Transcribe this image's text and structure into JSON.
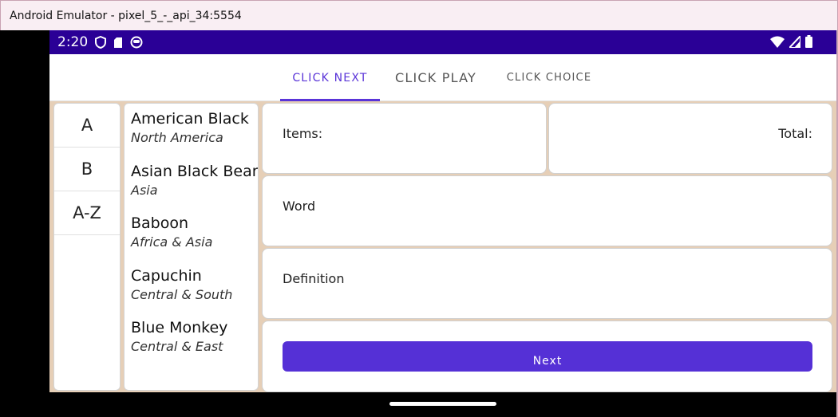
{
  "window": {
    "title": "Android Emulator - pixel_5_-_api_34:5554"
  },
  "status_bar": {
    "time": "2:20",
    "bg_color": "#2a0096"
  },
  "tabs": [
    {
      "label": "CLICK NEXT",
      "selected": true
    },
    {
      "label": "CLICK PLAY",
      "selected": false
    },
    {
      "label": "CLICK CHOICE",
      "selected": false
    }
  ],
  "letters": [
    "A",
    "B",
    "A-Z"
  ],
  "animals": [
    {
      "name": "American Black",
      "region": "North America"
    },
    {
      "name": "Asian Black Bear",
      "region": "Asia"
    },
    {
      "name": "Baboon",
      "region": "Africa & Asia"
    },
    {
      "name": "Capuchin",
      "region": "Central & South"
    },
    {
      "name": "Blue Monkey",
      "region": "Central & East"
    }
  ],
  "panels": {
    "items_label": "Items:",
    "total_label": "Total:",
    "word_label": "Word",
    "definition_label": "Definition"
  },
  "next_button": {
    "label": "Next"
  },
  "colors": {
    "accent": "#5a34d8",
    "button": "#5530d6",
    "content_bg": "#e6cfb7"
  }
}
